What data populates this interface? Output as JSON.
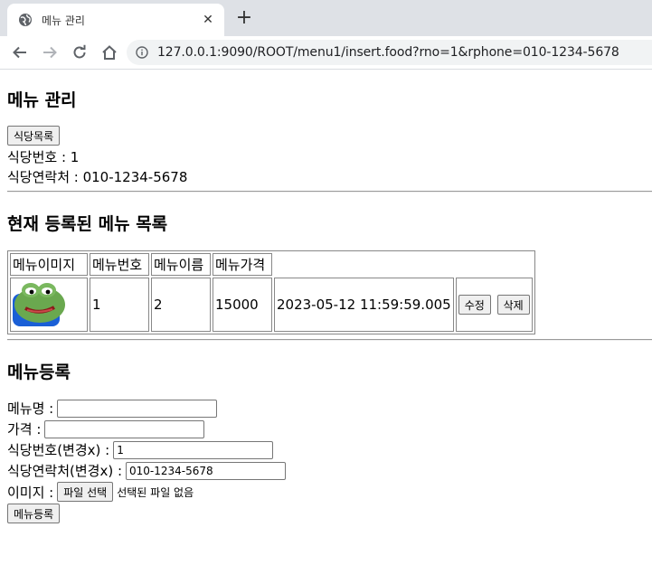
{
  "browser": {
    "tab_title": "메뉴 관리",
    "url": "127.0.0.1:9090/ROOT/menu1/insert.food?rno=1&rphone=010-1234-5678",
    "close_glyph": "✕",
    "newtab_glyph": "+"
  },
  "header": {
    "title": "메뉴 관리",
    "list_button": "식당목록",
    "restaurant_no": "식당번호 : 1",
    "restaurant_phone": "식당연락처 : 010-1234-5678"
  },
  "menu_list": {
    "title": "현재 등록된 메뉴 목록",
    "columns": [
      "메뉴이미지",
      "메뉴번호",
      "메뉴이름",
      "메뉴가격"
    ],
    "rows": [
      {
        "no": "1",
        "name": "2",
        "price": "15000",
        "date": "2023-05-12 11:59:59.005",
        "edit": "수정",
        "delete": "삭제"
      }
    ]
  },
  "register": {
    "title": "메뉴등록",
    "name_label": "메뉴명 :",
    "name_value": "",
    "price_label": "가격 :",
    "price_value": "",
    "rno_label": "식당번호(변경x) :",
    "rno_value": "1",
    "rphone_label": "식당연락처(변경x) :",
    "rphone_value": "010-1234-5678",
    "image_label": "이미지 :",
    "file_button": "파일 선택",
    "file_status": "선택된 파일 없음",
    "submit": "메뉴등록"
  },
  "colors": {
    "tabbar": "#dee1e6",
    "omnibox": "#f1f3f4",
    "frog_green": "#6aa84f",
    "frog_blue": "#1a5fd6"
  }
}
